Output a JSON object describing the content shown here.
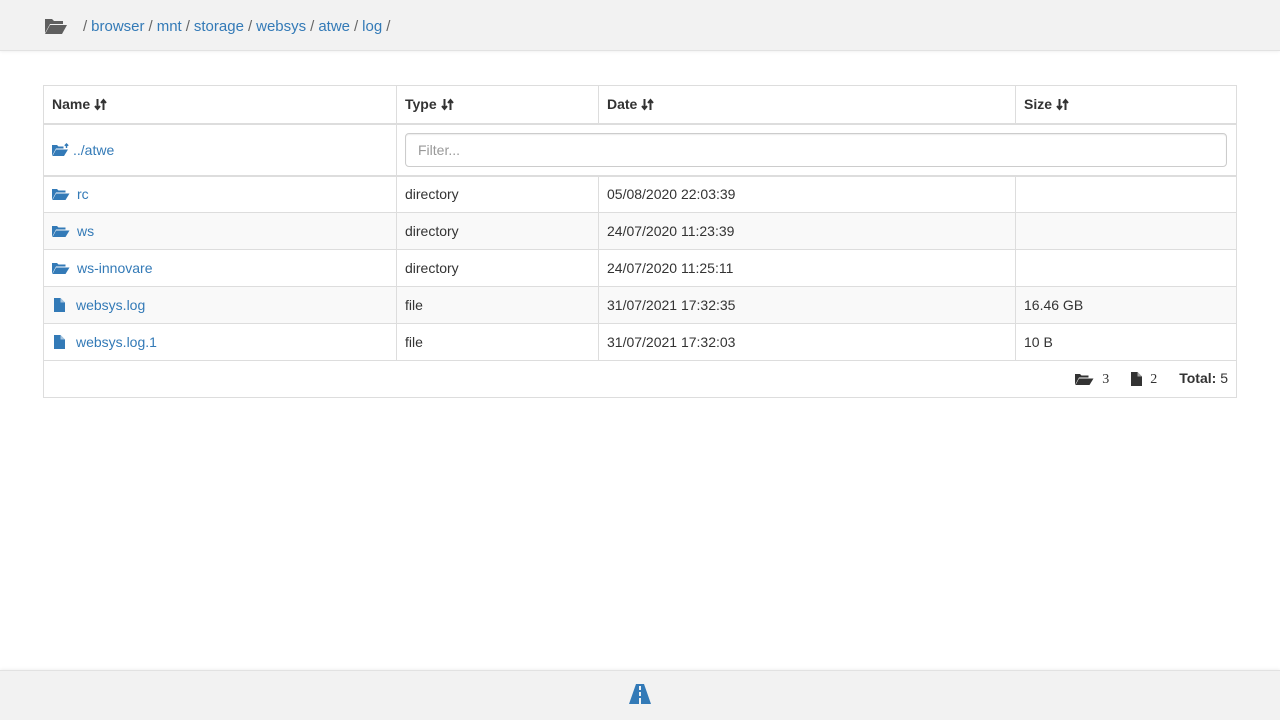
{
  "header": {
    "home_icon": "folder-open-icon",
    "breadcrumb": [
      {
        "label": "browser"
      },
      {
        "label": "mnt"
      },
      {
        "label": "storage"
      },
      {
        "label": "websys"
      },
      {
        "label": "atwe"
      },
      {
        "label": "log"
      }
    ],
    "separator": "/"
  },
  "table": {
    "columns": [
      {
        "label": "Name"
      },
      {
        "label": "Type"
      },
      {
        "label": "Date"
      },
      {
        "label": "Size"
      }
    ],
    "sort_icon": "sort-arrows-icon",
    "parent": {
      "label": "../atwe",
      "icon": "folder-up-icon"
    },
    "filter": {
      "placeholder": "Filter...",
      "value": ""
    },
    "rows": [
      {
        "name": "rc",
        "type": "directory",
        "date": "05/08/2020 22:03:39",
        "size": "",
        "icon": "folder-open-icon"
      },
      {
        "name": "ws",
        "type": "directory",
        "date": "24/07/2020 11:23:39",
        "size": "",
        "icon": "folder-open-icon"
      },
      {
        "name": "ws-innovare",
        "type": "directory",
        "date": "24/07/2020 11:25:11",
        "size": "",
        "icon": "folder-open-icon"
      },
      {
        "name": "websys.log",
        "type": "file",
        "date": "31/07/2021 17:32:35",
        "size": "16.46 GB",
        "icon": "file-icon"
      },
      {
        "name": "websys.log.1",
        "type": "file",
        "date": "31/07/2021 17:32:03",
        "size": "10 B",
        "icon": "file-icon"
      }
    ],
    "footer": {
      "dir_count": "3",
      "file_count": "2",
      "total_label": "Total:",
      "total_value": "5"
    }
  },
  "bottom": {
    "icon": "road-icon"
  },
  "colors": {
    "link": "#337ab7",
    "icon_blue": "#337ab7",
    "bar_bg": "#f2f2f2",
    "border": "#dddddd",
    "stripe": "#f9f9f9"
  }
}
